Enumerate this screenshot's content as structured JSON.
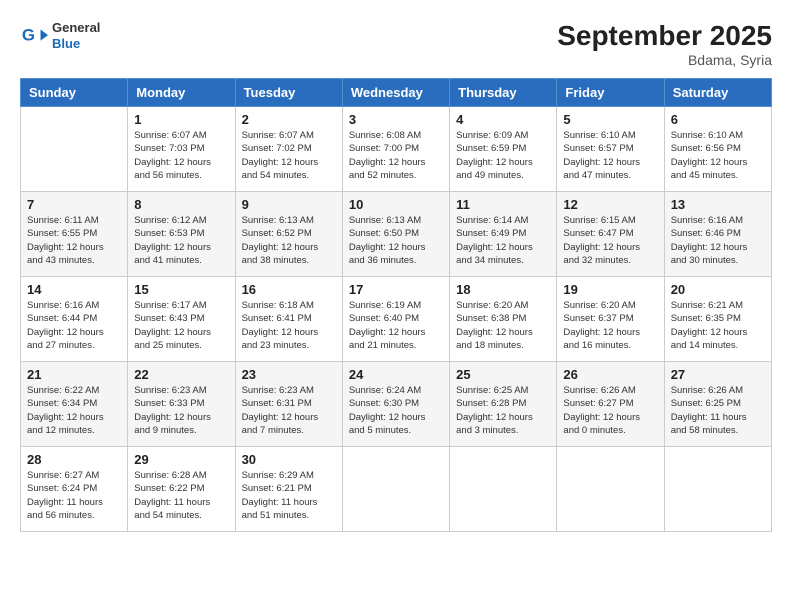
{
  "header": {
    "logo_line1": "General",
    "logo_line2": "Blue",
    "title": "September 2025",
    "subtitle": "Bdama, Syria"
  },
  "weekdays": [
    "Sunday",
    "Monday",
    "Tuesday",
    "Wednesday",
    "Thursday",
    "Friday",
    "Saturday"
  ],
  "weeks": [
    [
      {
        "day": "",
        "info": ""
      },
      {
        "day": "1",
        "info": "Sunrise: 6:07 AM\nSunset: 7:03 PM\nDaylight: 12 hours\nand 56 minutes."
      },
      {
        "day": "2",
        "info": "Sunrise: 6:07 AM\nSunset: 7:02 PM\nDaylight: 12 hours\nand 54 minutes."
      },
      {
        "day": "3",
        "info": "Sunrise: 6:08 AM\nSunset: 7:00 PM\nDaylight: 12 hours\nand 52 minutes."
      },
      {
        "day": "4",
        "info": "Sunrise: 6:09 AM\nSunset: 6:59 PM\nDaylight: 12 hours\nand 49 minutes."
      },
      {
        "day": "5",
        "info": "Sunrise: 6:10 AM\nSunset: 6:57 PM\nDaylight: 12 hours\nand 47 minutes."
      },
      {
        "day": "6",
        "info": "Sunrise: 6:10 AM\nSunset: 6:56 PM\nDaylight: 12 hours\nand 45 minutes."
      }
    ],
    [
      {
        "day": "7",
        "info": "Sunrise: 6:11 AM\nSunset: 6:55 PM\nDaylight: 12 hours\nand 43 minutes."
      },
      {
        "day": "8",
        "info": "Sunrise: 6:12 AM\nSunset: 6:53 PM\nDaylight: 12 hours\nand 41 minutes."
      },
      {
        "day": "9",
        "info": "Sunrise: 6:13 AM\nSunset: 6:52 PM\nDaylight: 12 hours\nand 38 minutes."
      },
      {
        "day": "10",
        "info": "Sunrise: 6:13 AM\nSunset: 6:50 PM\nDaylight: 12 hours\nand 36 minutes."
      },
      {
        "day": "11",
        "info": "Sunrise: 6:14 AM\nSunset: 6:49 PM\nDaylight: 12 hours\nand 34 minutes."
      },
      {
        "day": "12",
        "info": "Sunrise: 6:15 AM\nSunset: 6:47 PM\nDaylight: 12 hours\nand 32 minutes."
      },
      {
        "day": "13",
        "info": "Sunrise: 6:16 AM\nSunset: 6:46 PM\nDaylight: 12 hours\nand 30 minutes."
      }
    ],
    [
      {
        "day": "14",
        "info": "Sunrise: 6:16 AM\nSunset: 6:44 PM\nDaylight: 12 hours\nand 27 minutes."
      },
      {
        "day": "15",
        "info": "Sunrise: 6:17 AM\nSunset: 6:43 PM\nDaylight: 12 hours\nand 25 minutes."
      },
      {
        "day": "16",
        "info": "Sunrise: 6:18 AM\nSunset: 6:41 PM\nDaylight: 12 hours\nand 23 minutes."
      },
      {
        "day": "17",
        "info": "Sunrise: 6:19 AM\nSunset: 6:40 PM\nDaylight: 12 hours\nand 21 minutes."
      },
      {
        "day": "18",
        "info": "Sunrise: 6:20 AM\nSunset: 6:38 PM\nDaylight: 12 hours\nand 18 minutes."
      },
      {
        "day": "19",
        "info": "Sunrise: 6:20 AM\nSunset: 6:37 PM\nDaylight: 12 hours\nand 16 minutes."
      },
      {
        "day": "20",
        "info": "Sunrise: 6:21 AM\nSunset: 6:35 PM\nDaylight: 12 hours\nand 14 minutes."
      }
    ],
    [
      {
        "day": "21",
        "info": "Sunrise: 6:22 AM\nSunset: 6:34 PM\nDaylight: 12 hours\nand 12 minutes."
      },
      {
        "day": "22",
        "info": "Sunrise: 6:23 AM\nSunset: 6:33 PM\nDaylight: 12 hours\nand 9 minutes."
      },
      {
        "day": "23",
        "info": "Sunrise: 6:23 AM\nSunset: 6:31 PM\nDaylight: 12 hours\nand 7 minutes."
      },
      {
        "day": "24",
        "info": "Sunrise: 6:24 AM\nSunset: 6:30 PM\nDaylight: 12 hours\nand 5 minutes."
      },
      {
        "day": "25",
        "info": "Sunrise: 6:25 AM\nSunset: 6:28 PM\nDaylight: 12 hours\nand 3 minutes."
      },
      {
        "day": "26",
        "info": "Sunrise: 6:26 AM\nSunset: 6:27 PM\nDaylight: 12 hours\nand 0 minutes."
      },
      {
        "day": "27",
        "info": "Sunrise: 6:26 AM\nSunset: 6:25 PM\nDaylight: 11 hours\nand 58 minutes."
      }
    ],
    [
      {
        "day": "28",
        "info": "Sunrise: 6:27 AM\nSunset: 6:24 PM\nDaylight: 11 hours\nand 56 minutes."
      },
      {
        "day": "29",
        "info": "Sunrise: 6:28 AM\nSunset: 6:22 PM\nDaylight: 11 hours\nand 54 minutes."
      },
      {
        "day": "30",
        "info": "Sunrise: 6:29 AM\nSunset: 6:21 PM\nDaylight: 11 hours\nand 51 minutes."
      },
      {
        "day": "",
        "info": ""
      },
      {
        "day": "",
        "info": ""
      },
      {
        "day": "",
        "info": ""
      },
      {
        "day": "",
        "info": ""
      }
    ]
  ]
}
